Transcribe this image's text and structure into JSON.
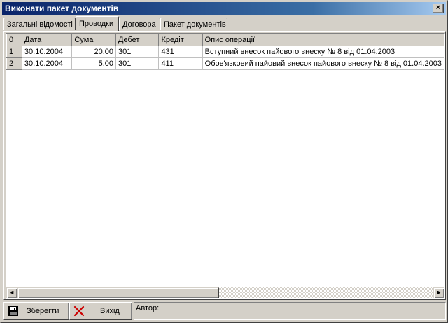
{
  "window": {
    "title": "Виконати пакет документів",
    "close_glyph": "×"
  },
  "tabs": [
    {
      "label": "Загальні відомості",
      "active": false
    },
    {
      "label": "Проводки",
      "active": true
    },
    {
      "label": "Договора",
      "active": false
    },
    {
      "label": "Пакет документів",
      "active": false
    }
  ],
  "grid": {
    "corner": "0",
    "columns": [
      "Дата",
      "Сума",
      "Дебет",
      "Кредіт",
      "Опис операції"
    ],
    "rows": [
      {
        "n": "1",
        "date": "30.10.2004",
        "sum": "20.00",
        "debit": "301",
        "credit": "431",
        "desc": "Вступний внесок пайового внеску № 8 від 01.04.2003"
      },
      {
        "n": "2",
        "date": "30.10.2004",
        "sum": "5.00",
        "debit": "301",
        "credit": "411",
        "desc": "Обов'язковий пайовий внесок пайового внеску № 8 від 01.04.2003"
      }
    ]
  },
  "scrollbar": {
    "left_glyph": "◄",
    "right_glyph": "►"
  },
  "toolbar": {
    "save_label": "Зберегти",
    "exit_label": "Вихід",
    "author_label": "Автор:"
  },
  "icons": {
    "save": "floppy-disk-icon",
    "exit": "red-x-icon"
  },
  "colors": {
    "titlebar": "#0a246a",
    "face": "#d4d0c8",
    "exit_icon": "#cc0000"
  }
}
